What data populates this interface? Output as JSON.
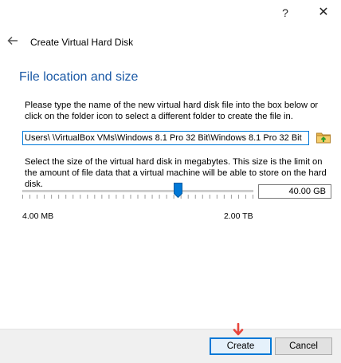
{
  "titlebar": {
    "help_label": "?",
    "close_label": "✕",
    "icons": [
      "question-mark-icon",
      "close-icon"
    ]
  },
  "header": {
    "back_icon": "back-arrow-icon",
    "title": "Create Virtual Hard Disk"
  },
  "section": {
    "title": "File location and size",
    "description": "Please type the name of the new virtual hard disk file into the box below or click on the folder icon to select a different folder to create the file in."
  },
  "file_location": {
    "value": "Users\\        \\VirtualBox VMs\\Windows 8.1 Pro 32 Bit\\Windows 8.1 Pro 32 Bit",
    "folder_icon": "folder-icon"
  },
  "size": {
    "description": "Select the size of the virtual hard disk in megabytes. This size is the limit on the amount of file data that a virtual machine will be able to store on the hard disk.",
    "value": "40.00 GB",
    "slider_fraction": 0.68,
    "min_label": "4.00 MB",
    "max_label": "2.00 TB"
  },
  "footer": {
    "create_label": "Create",
    "cancel_label": "Cancel"
  },
  "colors": {
    "accent": "#0078d7",
    "section_title": "#1c5aa6",
    "cursor_arrow": "#e8453c"
  }
}
